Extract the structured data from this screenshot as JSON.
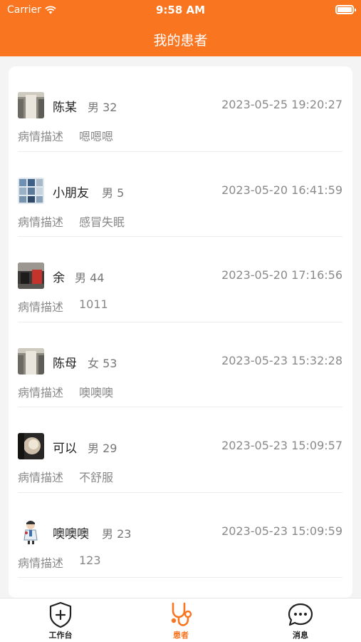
{
  "status_bar": {
    "carrier": "Carrier",
    "time": "9:58 AM"
  },
  "header": {
    "title": "我的患者"
  },
  "desc_label": "病情描述",
  "patients": [
    {
      "name": "陈某",
      "meta": "男 32",
      "date": "2023-05-25 19:20:27",
      "description": "嗯嗯嗯"
    },
    {
      "name": "小朋友",
      "meta": "男 5",
      "date": "2023-05-20 16:41:59",
      "description": "感冒失眠"
    },
    {
      "name": "余",
      "meta": "男 44",
      "date": "2023-05-20 17:16:56",
      "description": "1011"
    },
    {
      "name": "陈母",
      "meta": "女 53",
      "date": "2023-05-23 15:32:28",
      "description": "噢噢噢"
    },
    {
      "name": "可以",
      "meta": "男 29",
      "date": "2023-05-23 15:09:57",
      "description": "不舒服"
    },
    {
      "name": "噢噢噢",
      "meta": "男 23",
      "date": "2023-05-23 15:09:59",
      "description": "123"
    }
  ],
  "tabbar": {
    "workbench": "工作台",
    "patients": "患者",
    "messages": "消息"
  },
  "colors": {
    "accent": "#f97520"
  }
}
